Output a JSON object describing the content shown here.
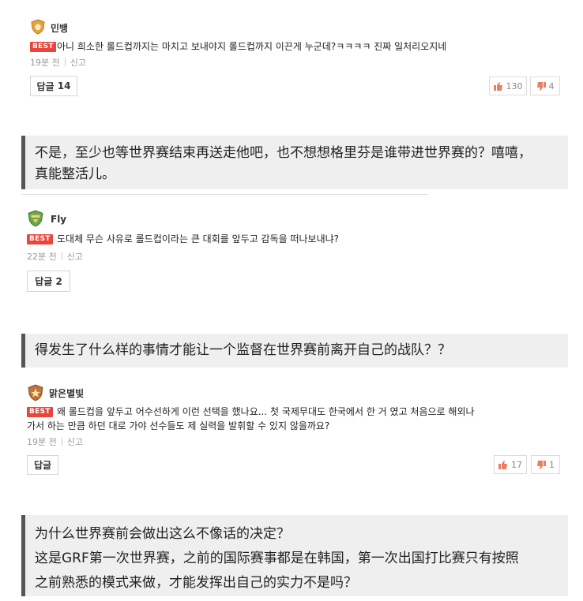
{
  "comments": [
    {
      "username": "민뱅",
      "best_label": "BEST",
      "text": "아니 희소한 롤드컵까지는 마치고 보내야지 롤드컵까지 이끈게 누군데?ㅋㅋㅋㅋ 진짜 일처리오지네",
      "time": "19분 전",
      "report": "신고",
      "reply_label": "답글",
      "reply_count": "14",
      "upvotes": "130",
      "downvotes": "4"
    },
    {
      "username": "Fly",
      "best_label": "BEST",
      "text": "도대체 무슨 사유로 롤드컵이라는 큰 대회를 앞두고 감독을 떠나보내냐?",
      "time": "22분 전",
      "report": "신고",
      "reply_label": "답글",
      "reply_count": "2"
    },
    {
      "username": "맑은별빛",
      "best_label": "BEST",
      "text_line1": "왜 롤드컵을 앞두고 어수선하게 이런 선택을 했나요... 첫 국제무대도 한국에서 한 거 였고 처음으로 해외나",
      "text_line2": "가서 하는 만큼 하던 대로 가야 선수들도 제 실력을 발휘할 수 있지 않을까요?",
      "time": "19분 전",
      "report": "신고",
      "reply_label": "답글",
      "upvotes": "17",
      "downvotes": "1"
    }
  ],
  "translations": [
    {
      "lines": [
        "不是，至少也等世界赛结束再送走他吧，也不想想格里芬是谁带进世界赛的？嘻嘻，",
        "真能整活儿。"
      ]
    },
    {
      "lines": [
        "得发生了什么样的事情才能让一个监督在世界赛前离开自己的战队？？"
      ]
    },
    {
      "lines": [
        "为什么世界赛前会做出这么不像话的决定？",
        "这是GRF第一次世界赛，之前的国际赛事都是在韩国，第一次出国打比赛只有按照",
        "之前熟悉的模式来做，才能发挥出自己的实力不是吗？"
      ]
    }
  ],
  "colors": {
    "best": "#e8453c",
    "quote_bg": "#efefef",
    "quote_border": "#555555"
  },
  "icons": {
    "badge1": "gold-shield-badge-icon",
    "badge2": "green-shield-badge-icon",
    "badge3": "bronze-star-badge-icon",
    "up": "thumbs-up-icon",
    "down": "thumbs-down-icon"
  }
}
